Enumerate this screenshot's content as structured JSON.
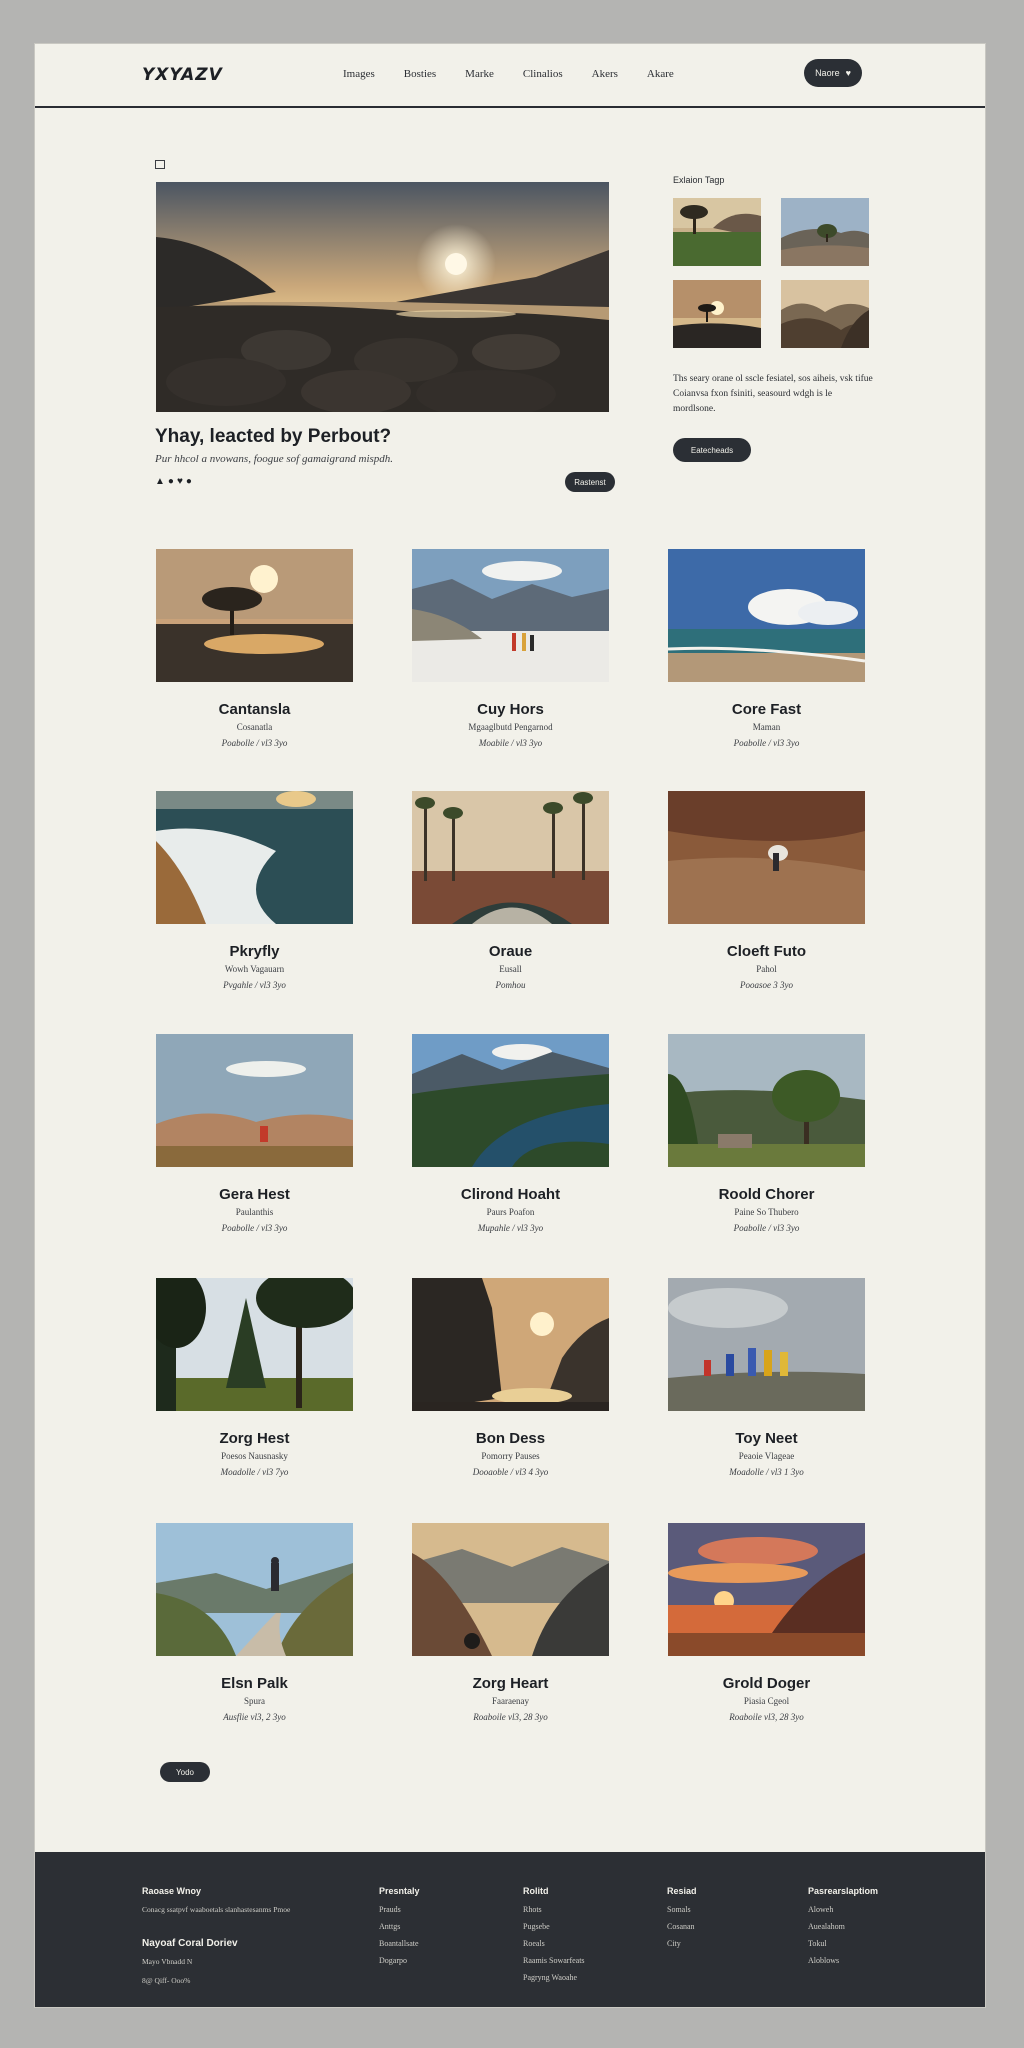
{
  "header": {
    "logo": "YXYAZV",
    "nav": [
      "Images",
      "Bosties",
      "Marke",
      "Clinalios",
      "Akers",
      "Akare"
    ],
    "button_label": "Naore"
  },
  "featured": {
    "title": "Yhay, leacted by Perbout?",
    "subtitle": "Pur hhcol a nvowans, foogue sof gamaigrand mispdh.",
    "icons": [
      "triangle-icon",
      "dot-icon",
      "heart-icon",
      "dot-icon"
    ],
    "button_label": "Rastenst"
  },
  "sidebar": {
    "title": "Exlaion Tagp",
    "description": "Ths seary orane ol sscle fesiatel, sos aiheis, vsk tifue Coianvsa fxon fsiniti, seasourd wdgh is le mordlsone.",
    "button_label": "Eatecheads"
  },
  "cards": [
    {
      "title": "Cantansla",
      "sub": "Cosanatla",
      "meta": "Poabolle / vl3 3yo",
      "scene": "tree-sunset"
    },
    {
      "title": "Cuy Hors",
      "sub": "Mgaaglbutd Pengarnod",
      "meta": "Moabile / vl3 3yo",
      "scene": "snow-hikers"
    },
    {
      "title": "Core Fast",
      "sub": "Maman",
      "meta": "Poabolle / vl3 3yo",
      "scene": "beach"
    },
    {
      "title": "Pkryfly",
      "sub": "Wowh Vagauarn",
      "meta": "Pvgahle / vl3 3yo",
      "scene": "coast"
    },
    {
      "title": "Oraue",
      "sub": "Eusall",
      "meta": "Pomhou",
      "scene": "palms"
    },
    {
      "title": "Cloeft Futo",
      "sub": "Pahol",
      "meta": "Pooasoe 3 3yo",
      "scene": "desert-person"
    },
    {
      "title": "Gera Hest",
      "sub": "Paulanthis",
      "meta": "Poabolle / vl3 3yo",
      "scene": "valley-person"
    },
    {
      "title": "Clirond Hoaht",
      "sub": "Paurs Poafon",
      "meta": "Mupahle / vl3 3yo",
      "scene": "river"
    },
    {
      "title": "Roold Chorer",
      "sub": "Paine So Thubero",
      "meta": "Poabolle / vl3 3yo",
      "scene": "tree-car"
    },
    {
      "title": "Zorg Hest",
      "sub": "Poesos Nausnasky",
      "meta": "Moadolle / vl3 7yo",
      "scene": "forest"
    },
    {
      "title": "Bon Dess",
      "sub": "Pomorry Pauses",
      "meta": "Dooaoble / vl3 4 3yo",
      "scene": "canyon"
    },
    {
      "title": "Toy Neet",
      "sub": "Peaoie Vlageae",
      "meta": "Moadolle / vl3 1 3yo",
      "scene": "group"
    },
    {
      "title": "Elsn Palk",
      "sub": "Spura",
      "meta": "Ausflie vl3, 2 3yo",
      "scene": "road"
    },
    {
      "title": "Zorg Heart",
      "sub": "Faaraenay",
      "meta": "Roaboile vl3, 28 3yo",
      "scene": "mountains"
    },
    {
      "title": "Grold Doger",
      "sub": "Piasia Cgeol",
      "meta": "Roaboile vl3, 28 3yo",
      "scene": "sunset-cliff"
    }
  ],
  "more_button_label": "Yodo",
  "footer": {
    "brand_title": "Raoase Wnoy",
    "brand_desc": "Conacg ssatpvf waaboetals slanhastesanms Pmoe",
    "contact_title": "Nayoaf Coral Doriev",
    "contact_lines": [
      "Mayo Vbnadd N",
      "8@ Qiff- Ooo%"
    ],
    "columns": [
      {
        "title": "Presntaly",
        "links": [
          "Prauds",
          "Anttgs",
          "Boantallsate",
          "Dogarpo"
        ]
      },
      {
        "title": "Rolitd",
        "links": [
          "Rhots",
          "Pugsebe",
          "Roeals",
          "Raamis Sowarfeats",
          "Pagryng Waoahe"
        ]
      },
      {
        "title": "Resiad",
        "links": [
          "Somals",
          "Cosanan",
          "City"
        ]
      },
      {
        "title": "Pasrearslaptiom",
        "links": [
          "Aloweh",
          "Auealahom",
          "Tokul",
          "Aloblows"
        ]
      }
    ]
  }
}
